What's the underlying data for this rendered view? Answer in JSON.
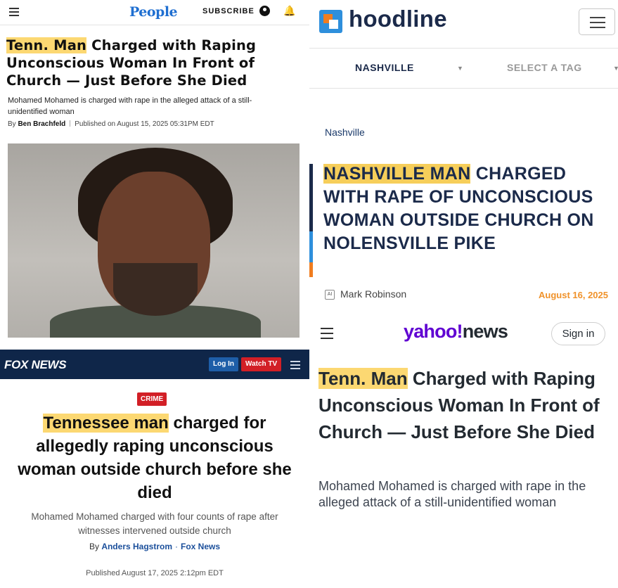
{
  "people": {
    "logo": "People",
    "subscribe": "SUBSCRIBE",
    "title_highlight": "Tenn. Man",
    "title_rest": " Charged with Raping Unconscious Woman In Front of Church — Just Before She Died",
    "dek": "Mohamed Mohamed is charged with rape in the alleged attack of a still-unidentified woman",
    "byline_prefix": "By ",
    "author": "Ben Brachfeld",
    "published": "Published on August 15, 2025 05:31PM EDT"
  },
  "fox": {
    "logo": "FOX NEWS",
    "login": "Log In",
    "watch": "Watch TV",
    "badge": "CRIME",
    "title_highlight": "Tennessee man",
    "title_rest": " charged for allegedly raping unconscious woman outside church before she died",
    "dek": "Mohamed Mohamed charged with four counts of rape after witnesses intervened outside church",
    "byline_prefix": "By ",
    "author": "Anders Hagstrom",
    "outlet": "Fox News",
    "published": "Published August 17, 2025 2:12pm EDT"
  },
  "hoodline": {
    "logo": "hoodline",
    "select_city": "NASHVILLE",
    "select_tag": "SELECT A TAG",
    "breadcrumb": "Nashville",
    "title_highlight": "NASHVILLE MAN",
    "title_rest": " CHARGED WITH RAPE OF UNCONSCIOUS WOMAN OUTSIDE CHURCH ON NOLENSVILLE PIKE",
    "author_badge": "AI",
    "author": "Mark Robinson",
    "date": "August 16, 2025"
  },
  "yahoo": {
    "logo_brand": "yahoo!",
    "logo_news": "news",
    "signin": "Sign in",
    "title_highlight": "Tenn. Man",
    "title_rest": " Charged with Raping Unconscious Woman In Front of Church — Just Before She Died",
    "dek": "Mohamed Mohamed is charged with rape in the alleged attack of a still-unidentified woman"
  },
  "colors": {
    "highlight": "#fcd872",
    "people_blue": "#1f6fd1",
    "fox_navy": "#0f2649",
    "fox_red": "#d21f26",
    "hoodline_navy": "#1b2a4a",
    "hoodline_orange": "#f0922a",
    "yahoo_purple": "#6001d2"
  }
}
